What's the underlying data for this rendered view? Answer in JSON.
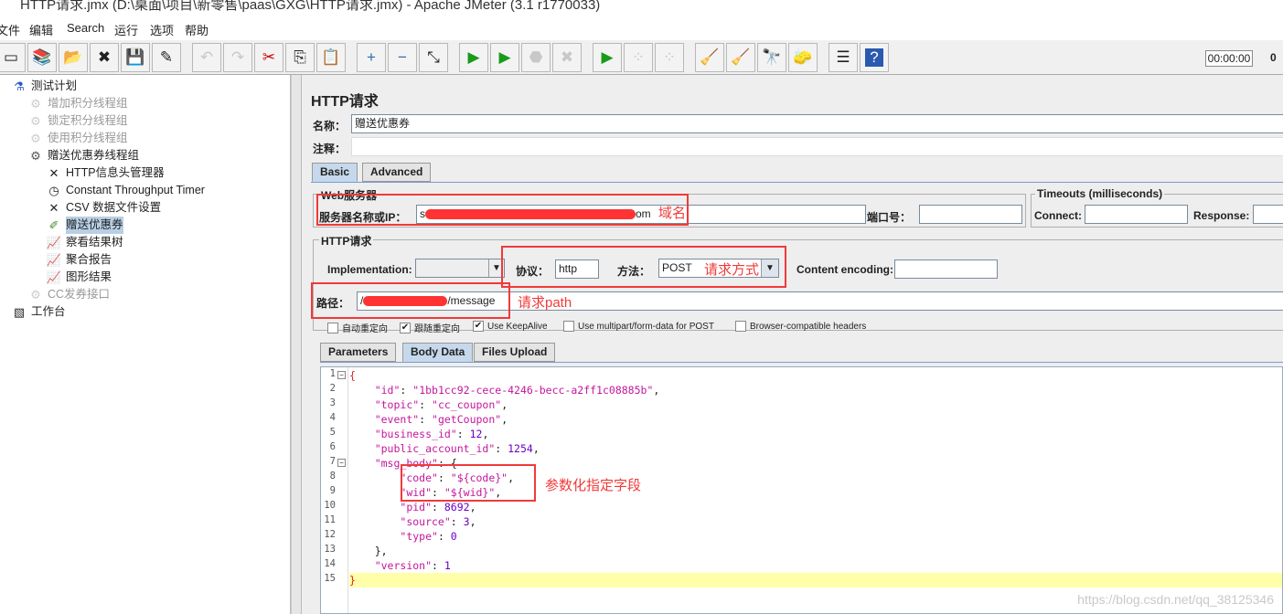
{
  "window": {
    "title": "HTTP请求.jmx (D:\\桌面\\项目\\新零售\\paas\\GXG\\HTTP请求.jmx) - Apache JMeter (3.1 r1770033)"
  },
  "menu": [
    "文件",
    "编辑",
    "Search",
    "运行",
    "选项",
    "帮助"
  ],
  "toolbar": {
    "buttons": [
      {
        "icon": "new-icon",
        "glyph": "▭"
      },
      {
        "icon": "templates-icon",
        "glyph": "📚"
      },
      {
        "icon": "open-icon",
        "glyph": "📂"
      },
      {
        "icon": "close-icon",
        "glyph": "✖"
      },
      {
        "icon": "save-icon",
        "glyph": "💾"
      },
      {
        "icon": "save-as-icon",
        "glyph": "✎"
      },
      {
        "icon": "undo-icon",
        "glyph": "↶",
        "disabled": true
      },
      {
        "icon": "redo-icon",
        "glyph": "↷",
        "disabled": true
      },
      {
        "icon": "cut-icon",
        "glyph": "✂"
      },
      {
        "icon": "copy-icon",
        "glyph": "⎘"
      },
      {
        "icon": "paste-icon",
        "glyph": "📋"
      },
      {
        "icon": "expand-icon",
        "glyph": "+"
      },
      {
        "icon": "collapse-icon",
        "glyph": "−"
      },
      {
        "icon": "toggle-icon",
        "glyph": "⤡"
      },
      {
        "icon": "start-icon",
        "glyph": "▶"
      },
      {
        "icon": "start-no-pause-icon",
        "glyph": "▶"
      },
      {
        "icon": "stop-icon",
        "glyph": "⬣",
        "disabled": true
      },
      {
        "icon": "shutdown-icon",
        "glyph": "✖",
        "disabled": true
      },
      {
        "icon": "remote-start-icon",
        "glyph": "▶"
      },
      {
        "icon": "remote-stop-icon",
        "glyph": "⁘",
        "disabled": true
      },
      {
        "icon": "remote-shutdown-icon",
        "glyph": "⁘",
        "disabled": true
      },
      {
        "icon": "clear-icon",
        "glyph": "🧹"
      },
      {
        "icon": "clear-all-icon",
        "glyph": "🧹"
      },
      {
        "icon": "search-icon",
        "glyph": "🔭"
      },
      {
        "icon": "reset-search-icon",
        "glyph": "🧽"
      },
      {
        "icon": "function-helper-icon",
        "glyph": "☰"
      },
      {
        "icon": "help-icon",
        "glyph": "?"
      }
    ],
    "timer": "00:00:00",
    "active_threads": "0"
  },
  "tree": [
    {
      "label": "测试计划",
      "icon": "flask-icon",
      "glyph": "⚗",
      "level": 0
    },
    {
      "label": "增加积分线程组",
      "icon": "gear-icon",
      "glyph": "⚙",
      "level": 1,
      "disabled": true
    },
    {
      "label": "锁定积分线程组",
      "icon": "gear-icon",
      "glyph": "⚙",
      "level": 1,
      "disabled": true
    },
    {
      "label": "使用积分线程组",
      "icon": "gear-icon",
      "glyph": "⚙",
      "level": 1,
      "disabled": true
    },
    {
      "label": "赠送优惠券线程组",
      "icon": "gear-icon",
      "glyph": "⚙",
      "level": 1
    },
    {
      "label": "HTTP信息头管理器",
      "icon": "wrench-icon",
      "glyph": "✕",
      "level": 2
    },
    {
      "label": "Constant Throughput Timer",
      "icon": "timer-icon",
      "glyph": "◷",
      "level": 2
    },
    {
      "label": "CSV 数据文件设置",
      "icon": "wrench-icon",
      "glyph": "✕",
      "level": 2
    },
    {
      "label": "赠送优惠券",
      "icon": "sampler-icon",
      "glyph": "✐",
      "level": 2,
      "selected": true
    },
    {
      "label": "察看结果树",
      "icon": "graph-icon",
      "glyph": "📈",
      "level": 2
    },
    {
      "label": "聚合报告",
      "icon": "graph-icon",
      "glyph": "📈",
      "level": 2
    },
    {
      "label": "图形结果",
      "icon": "graph-icon",
      "glyph": "📈",
      "level": 2
    },
    {
      "label": "CC发券接口",
      "icon": "gear-icon",
      "glyph": "⚙",
      "level": 1,
      "disabled": true
    },
    {
      "label": "工作台",
      "icon": "workbench-icon",
      "glyph": "▧",
      "level": 0
    }
  ],
  "main": {
    "heading": "HTTP请求",
    "name_label": "名称：",
    "name_value": "赠送优惠券",
    "comment_label": "注释：",
    "comment_value": "",
    "tabs": [
      "Basic",
      "Advanced"
    ],
    "web_server": {
      "title": "Web服务器",
      "server_label": "服务器名称或IP：",
      "server_prefix": "s",
      "server_suffix": "om",
      "port_label": "端口号：",
      "port_value": ""
    },
    "timeouts": {
      "title": "Timeouts (milliseconds)",
      "connect_label": "Connect:",
      "connect_value": "",
      "response_label": "Response:",
      "response_value": ""
    },
    "http_request": {
      "title": "HTTP请求",
      "impl_label": "Implementation:",
      "impl_value": "",
      "protocol_label": "协议：",
      "protocol_value": "http",
      "method_label": "方法：",
      "method_value": "POST",
      "encoding_label": "Content encoding:",
      "encoding_value": "",
      "path_label": "路径：",
      "path_prefix": "/",
      "path_suffix": "/message"
    },
    "checkboxes": [
      {
        "label": "自动重定向",
        "checked": false
      },
      {
        "label": "跟随重定向",
        "checked": true
      },
      {
        "label": "Use KeepAlive",
        "checked": true
      },
      {
        "label": "Use multipart/form-data for POST",
        "checked": false
      },
      {
        "label": "Browser-compatible headers",
        "checked": false
      }
    ],
    "body_tabs": [
      "Parameters",
      "Body Data",
      "Files Upload"
    ],
    "body_lines": [
      "{",
      "    \"id\": \"1bb1cc92-cece-4246-becc-a2ff1c08885b\",",
      "    \"topic\": \"cc_coupon\",",
      "    \"event\": \"getCoupon\",",
      "    \"business_id\": 12,",
      "    \"public_account_id\": 1254,",
      "    \"msg_body\": {",
      "        \"code\": \"${code}\",",
      "        \"wid\": \"${wid}\",",
      "        \"pid\": 8692,",
      "        \"source\": 3,",
      "        \"type\": 0",
      "    },",
      "    \"version\": 1",
      "}"
    ]
  },
  "annotations": {
    "domain": "域名",
    "method": "请求方式",
    "path": "请求path",
    "params": "参数化指定字段",
    "color": "#f03a3a"
  },
  "watermark": "https://blog.csdn.net/qq_38125346"
}
